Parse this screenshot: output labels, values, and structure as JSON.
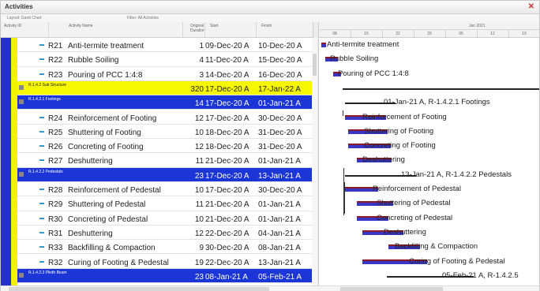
{
  "window": {
    "title": "Activities"
  },
  "toolbar": {
    "layout_label": "Layout: Gantt Chart",
    "filter_label": "Filter: All Activities"
  },
  "columns": {
    "activity_id": "Activity ID",
    "activity_name": "Activity Name",
    "duration": "Original Duration",
    "start": "Start",
    "finish": "Finish"
  },
  "timescale": {
    "top": "Jan 2021",
    "bottom": [
      "08",
      "15",
      "22",
      "29",
      "05",
      "12",
      "19"
    ]
  },
  "rows": [
    {
      "type": "activity",
      "id": "R21",
      "name": "Anti-termite treatment",
      "duration": "1",
      "start": "09-Dec-20 A",
      "finish": "10-Dec-20 A"
    },
    {
      "type": "activity",
      "id": "R22",
      "name": "Rubble Soiling",
      "duration": "4",
      "start": "11-Dec-20 A",
      "finish": "15-Dec-20 A"
    },
    {
      "type": "activity",
      "id": "R23",
      "name": "Pouring of PCC 1:4:8",
      "duration": "3",
      "start": "14-Dec-20 A",
      "finish": "16-Dec-20 A"
    },
    {
      "type": "wbs-yellow",
      "name": "R.1.4.2 Sub Structure",
      "duration": "320",
      "start": "17-Dec-20 A",
      "finish": "17-Jan-22 A"
    },
    {
      "type": "wbs-blue",
      "name": "R.1.4.2.1 Footings",
      "duration": "14",
      "start": "17-Dec-20 A",
      "finish": "01-Jan-21 A"
    },
    {
      "type": "activity",
      "id": "R24",
      "name": "Reinforcement of Footing",
      "duration": "12",
      "start": "17-Dec-20 A",
      "finish": "30-Dec-20 A"
    },
    {
      "type": "activity",
      "id": "R25",
      "name": "Shuttering of Footing",
      "duration": "10",
      "start": "18-Dec-20 A",
      "finish": "31-Dec-20 A"
    },
    {
      "type": "activity",
      "id": "R26",
      "name": "Concreting of Footing",
      "duration": "12",
      "start": "18-Dec-20 A",
      "finish": "31-Dec-20 A"
    },
    {
      "type": "activity",
      "id": "R27",
      "name": "Deshuttering",
      "duration": "11",
      "start": "21-Dec-20 A",
      "finish": "01-Jan-21 A"
    },
    {
      "type": "wbs-blue",
      "name": "R.1.4.2.2 Pedestals",
      "duration": "23",
      "start": "17-Dec-20 A",
      "finish": "13-Jan-21 A"
    },
    {
      "type": "activity",
      "id": "R28",
      "name": "Reinforcement of Pedestal",
      "duration": "10",
      "start": "17-Dec-20 A",
      "finish": "30-Dec-20 A"
    },
    {
      "type": "activity",
      "id": "R29",
      "name": "Shuttering of Pedestal",
      "duration": "11",
      "start": "21-Dec-20 A",
      "finish": "01-Jan-21 A"
    },
    {
      "type": "activity",
      "id": "R30",
      "name": "Concreting of Pedestal",
      "duration": "10",
      "start": "21-Dec-20 A",
      "finish": "01-Jan-21 A"
    },
    {
      "type": "activity",
      "id": "R31",
      "name": "Deshuttering",
      "duration": "12",
      "start": "22-Dec-20 A",
      "finish": "04-Jan-21 A"
    },
    {
      "type": "activity",
      "id": "R33",
      "name": "Backfilling & Compaction",
      "duration": "9",
      "start": "30-Dec-20 A",
      "finish": "08-Jan-21 A"
    },
    {
      "type": "activity",
      "id": "R32",
      "name": "Curing of Footing & Pedestal",
      "duration": "19",
      "start": "22-Dec-20 A",
      "finish": "13-Jan-21 A"
    },
    {
      "type": "wbs-blue",
      "name": "R.1.4.2.3 Plinth Beam",
      "duration": "23",
      "start": "08-Jan-21 A",
      "finish": "05-Feb-21 A"
    }
  ],
  "gantt_labels": [
    {
      "text": "Anti-termite treatment"
    },
    {
      "text": "Rubble Soiling"
    },
    {
      "text": "Pouring of PCC 1:4:8"
    },
    {
      "text": "01-Jan-21 A, R-1.4.2.1  Footings"
    },
    {
      "text": "Reinforcement of Footing"
    },
    {
      "text": "Shuttering of Footing"
    },
    {
      "text": "Concreting of Footing"
    },
    {
      "text": "Deshuttering"
    },
    {
      "text": "13-Jan-21 A, R-1.4.2.2  Pedestals"
    },
    {
      "text": "Reinforcement of Pedestal"
    },
    {
      "text": "Shuttering of Pedestal"
    },
    {
      "text": "Concreting of Pedestal"
    },
    {
      "text": "Deshuttering"
    },
    {
      "text": "Backfilling & Compaction"
    },
    {
      "text": "Curing of Footing & Pedestal"
    },
    {
      "text": "05-Feb-21 A, R-1.4.2.5"
    }
  ],
  "colors": {
    "wbs_blue": "#1b35d6",
    "wbs_yellow": "#f7f700",
    "bar": "#3a37c5",
    "bar_top": "#8b1a2a"
  }
}
